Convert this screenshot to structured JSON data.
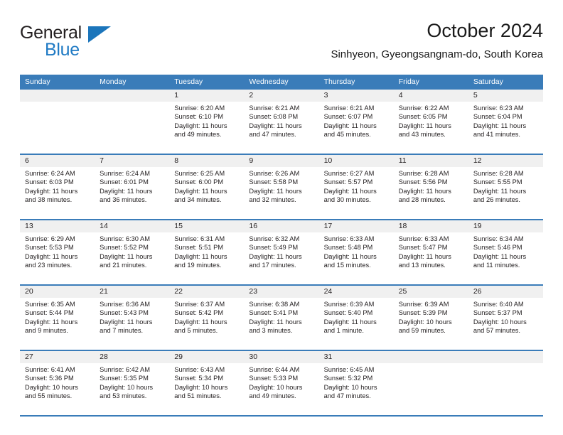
{
  "brand": {
    "name_part1": "General",
    "name_part2": "Blue",
    "accent_color": "#1b75bb"
  },
  "header": {
    "title": "October 2024",
    "location": "Sinhyeon, Gyeongsangnam-do, South Korea"
  },
  "theme": {
    "header_row_color": "#3a7cb9",
    "daynum_band_color": "#f0f0f0",
    "text_color": "#231f20"
  },
  "weekdays": [
    "Sunday",
    "Monday",
    "Tuesday",
    "Wednesday",
    "Thursday",
    "Friday",
    "Saturday"
  ],
  "labels": {
    "sunrise_prefix": "Sunrise:",
    "sunset_prefix": "Sunset:",
    "daylight_prefix": "Daylight:"
  },
  "weeks": [
    [
      {
        "day": "",
        "sunrise": "",
        "sunset": "",
        "daylight_l1": "",
        "daylight_l2": ""
      },
      {
        "day": "",
        "sunrise": "",
        "sunset": "",
        "daylight_l1": "",
        "daylight_l2": ""
      },
      {
        "day": "1",
        "sunrise": "Sunrise: 6:20 AM",
        "sunset": "Sunset: 6:10 PM",
        "daylight_l1": "Daylight: 11 hours",
        "daylight_l2": "and 49 minutes."
      },
      {
        "day": "2",
        "sunrise": "Sunrise: 6:21 AM",
        "sunset": "Sunset: 6:08 PM",
        "daylight_l1": "Daylight: 11 hours",
        "daylight_l2": "and 47 minutes."
      },
      {
        "day": "3",
        "sunrise": "Sunrise: 6:21 AM",
        "sunset": "Sunset: 6:07 PM",
        "daylight_l1": "Daylight: 11 hours",
        "daylight_l2": "and 45 minutes."
      },
      {
        "day": "4",
        "sunrise": "Sunrise: 6:22 AM",
        "sunset": "Sunset: 6:05 PM",
        "daylight_l1": "Daylight: 11 hours",
        "daylight_l2": "and 43 minutes."
      },
      {
        "day": "5",
        "sunrise": "Sunrise: 6:23 AM",
        "sunset": "Sunset: 6:04 PM",
        "daylight_l1": "Daylight: 11 hours",
        "daylight_l2": "and 41 minutes."
      }
    ],
    [
      {
        "day": "6",
        "sunrise": "Sunrise: 6:24 AM",
        "sunset": "Sunset: 6:03 PM",
        "daylight_l1": "Daylight: 11 hours",
        "daylight_l2": "and 38 minutes."
      },
      {
        "day": "7",
        "sunrise": "Sunrise: 6:24 AM",
        "sunset": "Sunset: 6:01 PM",
        "daylight_l1": "Daylight: 11 hours",
        "daylight_l2": "and 36 minutes."
      },
      {
        "day": "8",
        "sunrise": "Sunrise: 6:25 AM",
        "sunset": "Sunset: 6:00 PM",
        "daylight_l1": "Daylight: 11 hours",
        "daylight_l2": "and 34 minutes."
      },
      {
        "day": "9",
        "sunrise": "Sunrise: 6:26 AM",
        "sunset": "Sunset: 5:58 PM",
        "daylight_l1": "Daylight: 11 hours",
        "daylight_l2": "and 32 minutes."
      },
      {
        "day": "10",
        "sunrise": "Sunrise: 6:27 AM",
        "sunset": "Sunset: 5:57 PM",
        "daylight_l1": "Daylight: 11 hours",
        "daylight_l2": "and 30 minutes."
      },
      {
        "day": "11",
        "sunrise": "Sunrise: 6:28 AM",
        "sunset": "Sunset: 5:56 PM",
        "daylight_l1": "Daylight: 11 hours",
        "daylight_l2": "and 28 minutes."
      },
      {
        "day": "12",
        "sunrise": "Sunrise: 6:28 AM",
        "sunset": "Sunset: 5:55 PM",
        "daylight_l1": "Daylight: 11 hours",
        "daylight_l2": "and 26 minutes."
      }
    ],
    [
      {
        "day": "13",
        "sunrise": "Sunrise: 6:29 AM",
        "sunset": "Sunset: 5:53 PM",
        "daylight_l1": "Daylight: 11 hours",
        "daylight_l2": "and 23 minutes."
      },
      {
        "day": "14",
        "sunrise": "Sunrise: 6:30 AM",
        "sunset": "Sunset: 5:52 PM",
        "daylight_l1": "Daylight: 11 hours",
        "daylight_l2": "and 21 minutes."
      },
      {
        "day": "15",
        "sunrise": "Sunrise: 6:31 AM",
        "sunset": "Sunset: 5:51 PM",
        "daylight_l1": "Daylight: 11 hours",
        "daylight_l2": "and 19 minutes."
      },
      {
        "day": "16",
        "sunrise": "Sunrise: 6:32 AM",
        "sunset": "Sunset: 5:49 PM",
        "daylight_l1": "Daylight: 11 hours",
        "daylight_l2": "and 17 minutes."
      },
      {
        "day": "17",
        "sunrise": "Sunrise: 6:33 AM",
        "sunset": "Sunset: 5:48 PM",
        "daylight_l1": "Daylight: 11 hours",
        "daylight_l2": "and 15 minutes."
      },
      {
        "day": "18",
        "sunrise": "Sunrise: 6:33 AM",
        "sunset": "Sunset: 5:47 PM",
        "daylight_l1": "Daylight: 11 hours",
        "daylight_l2": "and 13 minutes."
      },
      {
        "day": "19",
        "sunrise": "Sunrise: 6:34 AM",
        "sunset": "Sunset: 5:46 PM",
        "daylight_l1": "Daylight: 11 hours",
        "daylight_l2": "and 11 minutes."
      }
    ],
    [
      {
        "day": "20",
        "sunrise": "Sunrise: 6:35 AM",
        "sunset": "Sunset: 5:44 PM",
        "daylight_l1": "Daylight: 11 hours",
        "daylight_l2": "and 9 minutes."
      },
      {
        "day": "21",
        "sunrise": "Sunrise: 6:36 AM",
        "sunset": "Sunset: 5:43 PM",
        "daylight_l1": "Daylight: 11 hours",
        "daylight_l2": "and 7 minutes."
      },
      {
        "day": "22",
        "sunrise": "Sunrise: 6:37 AM",
        "sunset": "Sunset: 5:42 PM",
        "daylight_l1": "Daylight: 11 hours",
        "daylight_l2": "and 5 minutes."
      },
      {
        "day": "23",
        "sunrise": "Sunrise: 6:38 AM",
        "sunset": "Sunset: 5:41 PM",
        "daylight_l1": "Daylight: 11 hours",
        "daylight_l2": "and 3 minutes."
      },
      {
        "day": "24",
        "sunrise": "Sunrise: 6:39 AM",
        "sunset": "Sunset: 5:40 PM",
        "daylight_l1": "Daylight: 11 hours",
        "daylight_l2": "and 1 minute."
      },
      {
        "day": "25",
        "sunrise": "Sunrise: 6:39 AM",
        "sunset": "Sunset: 5:39 PM",
        "daylight_l1": "Daylight: 10 hours",
        "daylight_l2": "and 59 minutes."
      },
      {
        "day": "26",
        "sunrise": "Sunrise: 6:40 AM",
        "sunset": "Sunset: 5:37 PM",
        "daylight_l1": "Daylight: 10 hours",
        "daylight_l2": "and 57 minutes."
      }
    ],
    [
      {
        "day": "27",
        "sunrise": "Sunrise: 6:41 AM",
        "sunset": "Sunset: 5:36 PM",
        "daylight_l1": "Daylight: 10 hours",
        "daylight_l2": "and 55 minutes."
      },
      {
        "day": "28",
        "sunrise": "Sunrise: 6:42 AM",
        "sunset": "Sunset: 5:35 PM",
        "daylight_l1": "Daylight: 10 hours",
        "daylight_l2": "and 53 minutes."
      },
      {
        "day": "29",
        "sunrise": "Sunrise: 6:43 AM",
        "sunset": "Sunset: 5:34 PM",
        "daylight_l1": "Daylight: 10 hours",
        "daylight_l2": "and 51 minutes."
      },
      {
        "day": "30",
        "sunrise": "Sunrise: 6:44 AM",
        "sunset": "Sunset: 5:33 PM",
        "daylight_l1": "Daylight: 10 hours",
        "daylight_l2": "and 49 minutes."
      },
      {
        "day": "31",
        "sunrise": "Sunrise: 6:45 AM",
        "sunset": "Sunset: 5:32 PM",
        "daylight_l1": "Daylight: 10 hours",
        "daylight_l2": "and 47 minutes."
      },
      {
        "day": "",
        "sunrise": "",
        "sunset": "",
        "daylight_l1": "",
        "daylight_l2": ""
      },
      {
        "day": "",
        "sunrise": "",
        "sunset": "",
        "daylight_l1": "",
        "daylight_l2": ""
      }
    ]
  ]
}
